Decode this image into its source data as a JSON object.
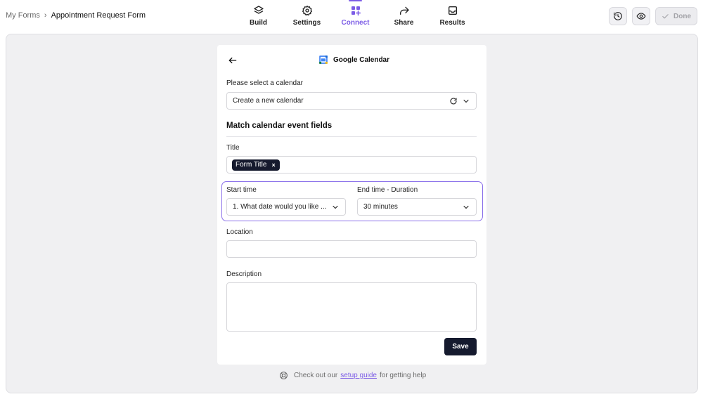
{
  "breadcrumb": {
    "root": "My Forms",
    "separator": "›",
    "current": "Appointment Request Form"
  },
  "nav": {
    "tabs": [
      {
        "label": "Build",
        "icon": "layers-icon",
        "active": false
      },
      {
        "label": "Settings",
        "icon": "gear-icon",
        "active": false
      },
      {
        "label": "Connect",
        "icon": "grid-plus-icon",
        "active": true
      },
      {
        "label": "Share",
        "icon": "share-arrow-icon",
        "active": false
      },
      {
        "label": "Results",
        "icon": "inbox-icon",
        "active": false
      }
    ]
  },
  "header_actions": {
    "history_icon": "history-icon",
    "preview_icon": "eye-icon",
    "done_label": "Done"
  },
  "card": {
    "title": "Google Calendar",
    "calendar_label": "Please select a calendar",
    "calendar_value": "Create a new calendar",
    "section_title": "Match calendar event fields",
    "title_label": "Title",
    "title_tag": "Form Title",
    "title_tag_remove": "×",
    "start_label": "Start time",
    "start_value": "1. What date would you like ...",
    "end_label": "End time - Duration",
    "end_value": "30 minutes",
    "location_label": "Location",
    "location_value": "",
    "description_label": "Description",
    "description_value": "",
    "save_label": "Save"
  },
  "help": {
    "prefix": "Check out our",
    "link": "setup guide",
    "suffix": "for getting help"
  },
  "colors": {
    "accent": "#7c5ce6",
    "primary_button": "#151a2e",
    "canvas": "#f0f0f2"
  }
}
